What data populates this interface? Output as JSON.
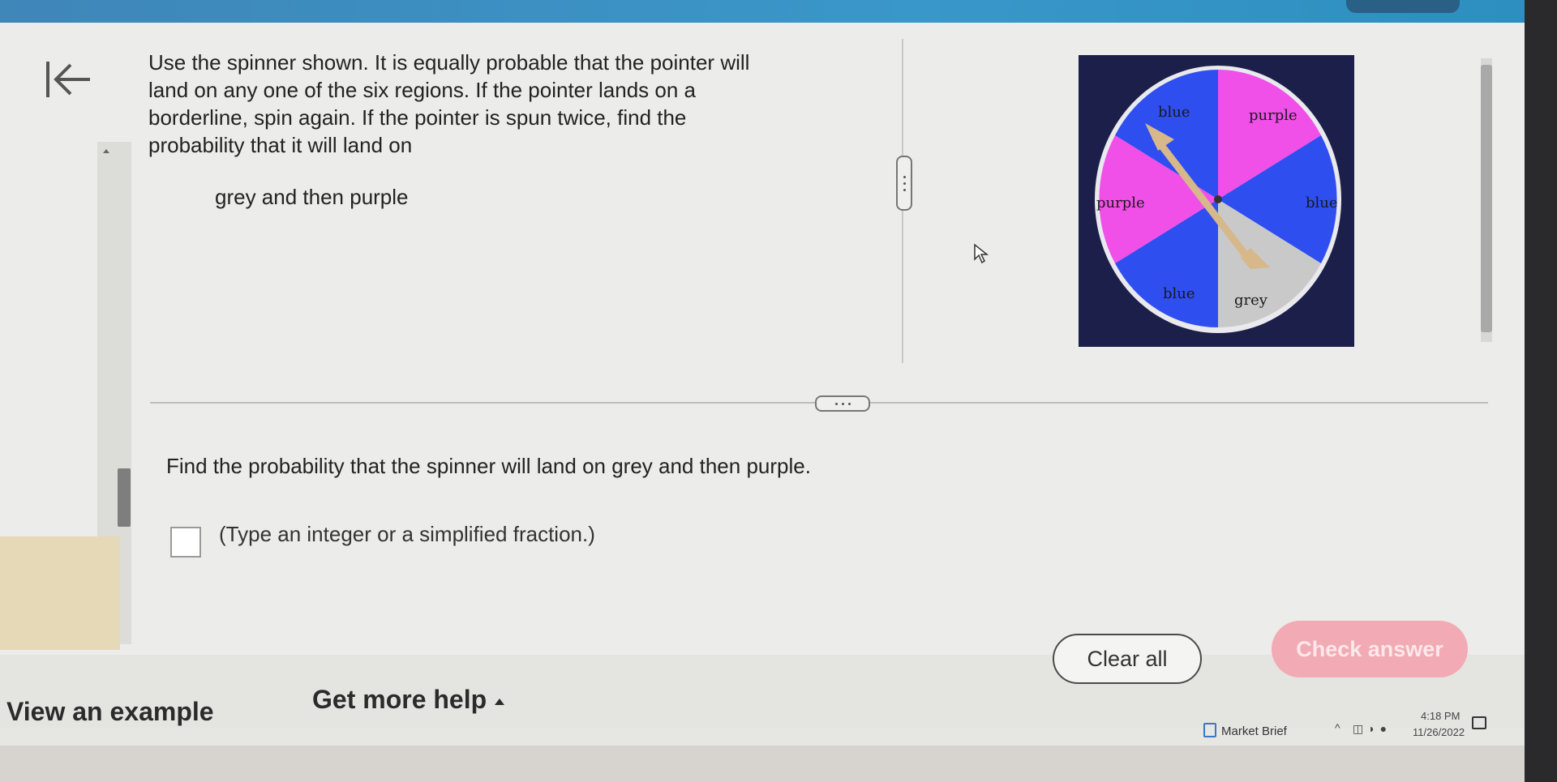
{
  "question": {
    "line1": "Use the spinner shown.  It is equally probable that the pointer will",
    "line2": "land on any one of the six regions.  If the pointer lands on a",
    "line3": "borderline, spin again.  If the pointer is spun twice, find the",
    "line4": "probability that it will land on",
    "sub_item": "grey and then purple"
  },
  "spinner": {
    "labels": {
      "top_left": "blue",
      "top_right": "purple",
      "left": "purple",
      "right": "blue",
      "bottom_left": "blue",
      "bottom_right": "grey"
    },
    "colors": {
      "blue": "#2e4ef0",
      "purple": "#f04fe8",
      "grey": "#c9c9c9",
      "background": "#1c1f4a",
      "rim": "#e9e9ee",
      "arrow": "#d6b88a"
    }
  },
  "answer": {
    "prompt": "Find the probability that the spinner will land on grey and then purple.",
    "hint": "(Type an integer or a simplified fraction.)"
  },
  "buttons": {
    "clear_all": "Clear all",
    "check_answer": "Check answer",
    "view_example": "View an example",
    "get_more_help": "Get more help"
  },
  "taskbar": {
    "news": "Market Brief",
    "time": "4:18 PM",
    "date": "11/26/2022"
  }
}
